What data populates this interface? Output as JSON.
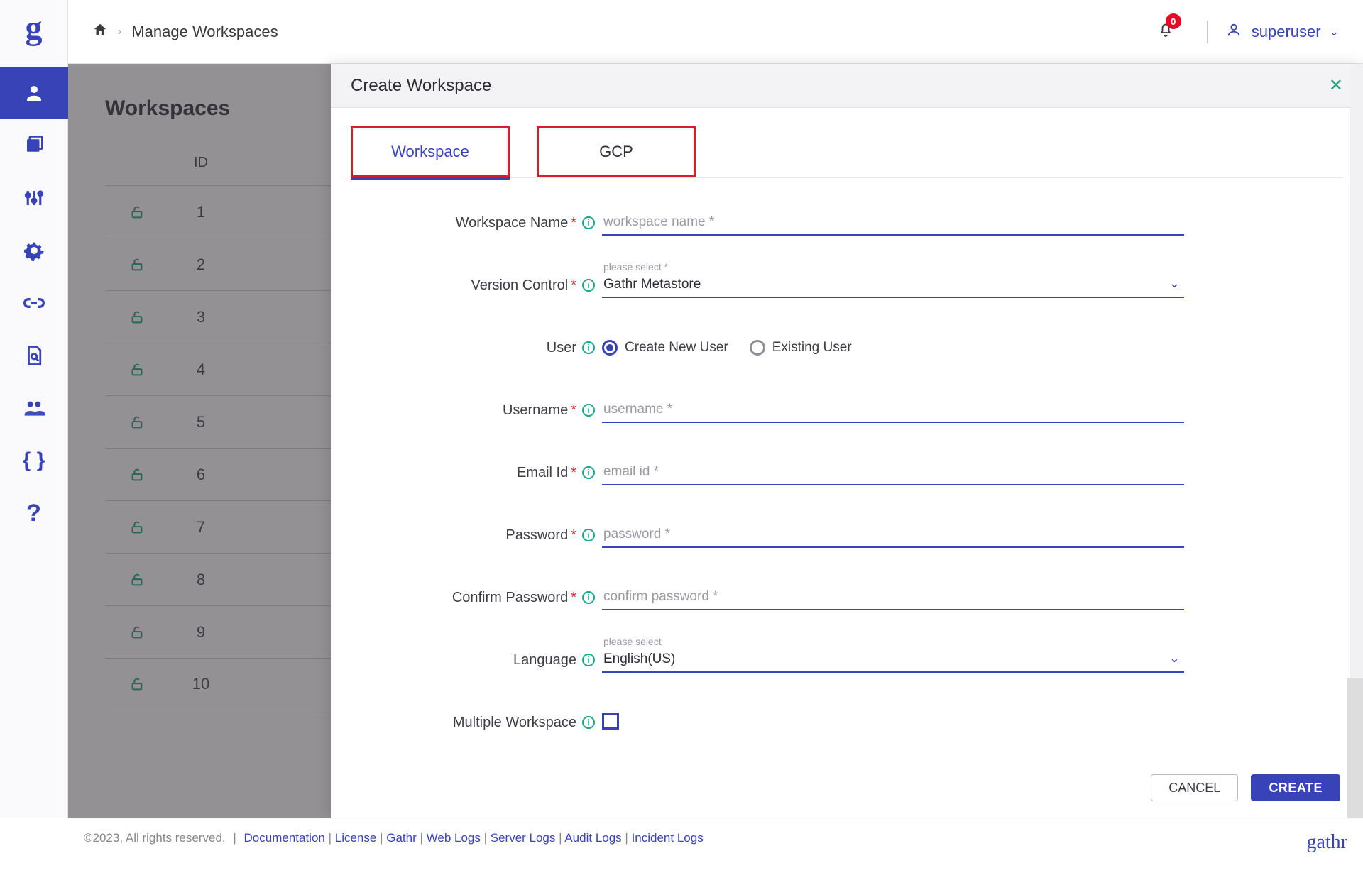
{
  "header": {
    "breadcrumb": "Manage Workspaces",
    "notif_count": "0",
    "username": "superuser"
  },
  "page": {
    "title": "Workspaces",
    "id_header": "ID",
    "rows": [
      "1",
      "2",
      "3",
      "4",
      "5",
      "6",
      "7",
      "8",
      "9",
      "10"
    ]
  },
  "modal": {
    "title": "Create Workspace",
    "tabs": {
      "workspace": "Workspace",
      "gcp": "GCP"
    },
    "labels": {
      "workspace_name": "Workspace Name",
      "version_control": "Version Control",
      "user": "User",
      "username": "Username",
      "email": "Email Id",
      "password": "Password",
      "confirm_password": "Confirm Password",
      "language": "Language",
      "multiple_workspace": "Multiple Workspace"
    },
    "placeholders": {
      "workspace_name": "workspace name *",
      "version_select": "please select *",
      "username": "username *",
      "email": "email id *",
      "password": "password *",
      "confirm_password": "confirm password *",
      "language_select": "please select"
    },
    "values": {
      "version_control": "Gathr Metastore",
      "language": "English(US)"
    },
    "radios": {
      "create_new": "Create New User",
      "existing": "Existing User"
    },
    "buttons": {
      "cancel": "CANCEL",
      "create": "CREATE"
    }
  },
  "footer": {
    "copyright": "©2023, All rights reserved.",
    "links": [
      "Documentation",
      "License",
      "Gathr",
      "Web Logs",
      "Server Logs",
      "Audit Logs",
      "Incident Logs"
    ],
    "brand": "gathr"
  }
}
